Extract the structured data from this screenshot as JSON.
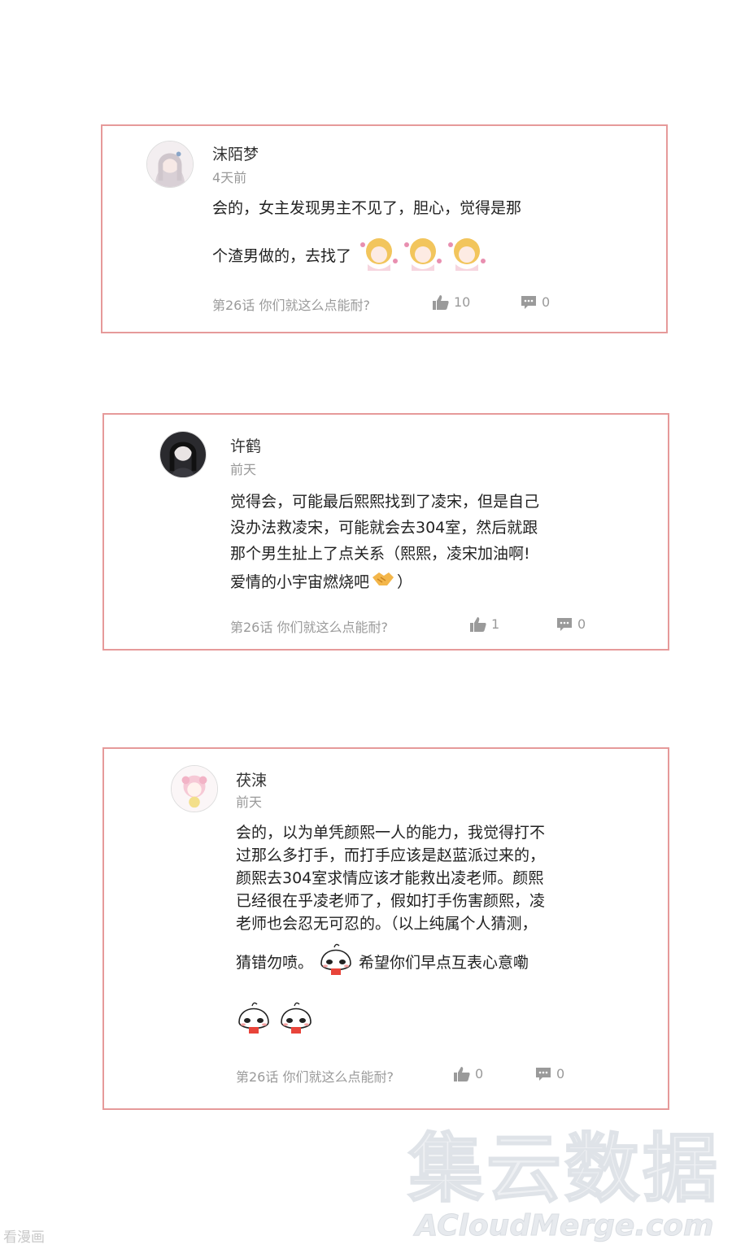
{
  "comments": [
    {
      "username": "沫陌梦",
      "time": "4天前",
      "lines": [
        "会的，女主发现男主不见了，胆心，觉得是那",
        "个渣男做的，去找了"
      ],
      "episode": "第26话 你们就这么点能耐?",
      "likes": "10",
      "replies": "0"
    },
    {
      "username": "许鹤",
      "time": "前天",
      "lines": [
        "觉得会，可能最后熙熙找到了凌宋，但是自己",
        "没办法救凌宋，可能就会去304室，然后就跟",
        "那个男生扯上了点关系（熙熙，凌宋加油啊!",
        "爱情的小宇宙燃烧吧",
        "）"
      ],
      "episode": "第26话 你们就这么点能耐?",
      "likes": "1",
      "replies": "0"
    },
    {
      "username": "茯涑",
      "time": "前天",
      "lines": [
        "会的，以为单凭颜熙一人的能力，我觉得打不",
        "过那么多打手，而打手应该是赵蓝派过来的，",
        "颜熙去304室求情应该才能救出凌老师。颜熙",
        "已经很在乎凌老师了，假如打手伤害颜熙，凌",
        "老师也会忍无可忍的。（以上纯属个人猜测，",
        "猜错勿喷。",
        "希望你们早点互表心意嘞"
      ],
      "episode": "第26话 你们就这么点能耐?",
      "likes": "0",
      "replies": "0"
    }
  ],
  "watermark": {
    "cn": "集云数据",
    "en": "ACloudMerge.com"
  },
  "corner_brand": "看漫画",
  "colors": {
    "card_border": "#e69a9a",
    "meta_gray": "#9a9a9a"
  }
}
